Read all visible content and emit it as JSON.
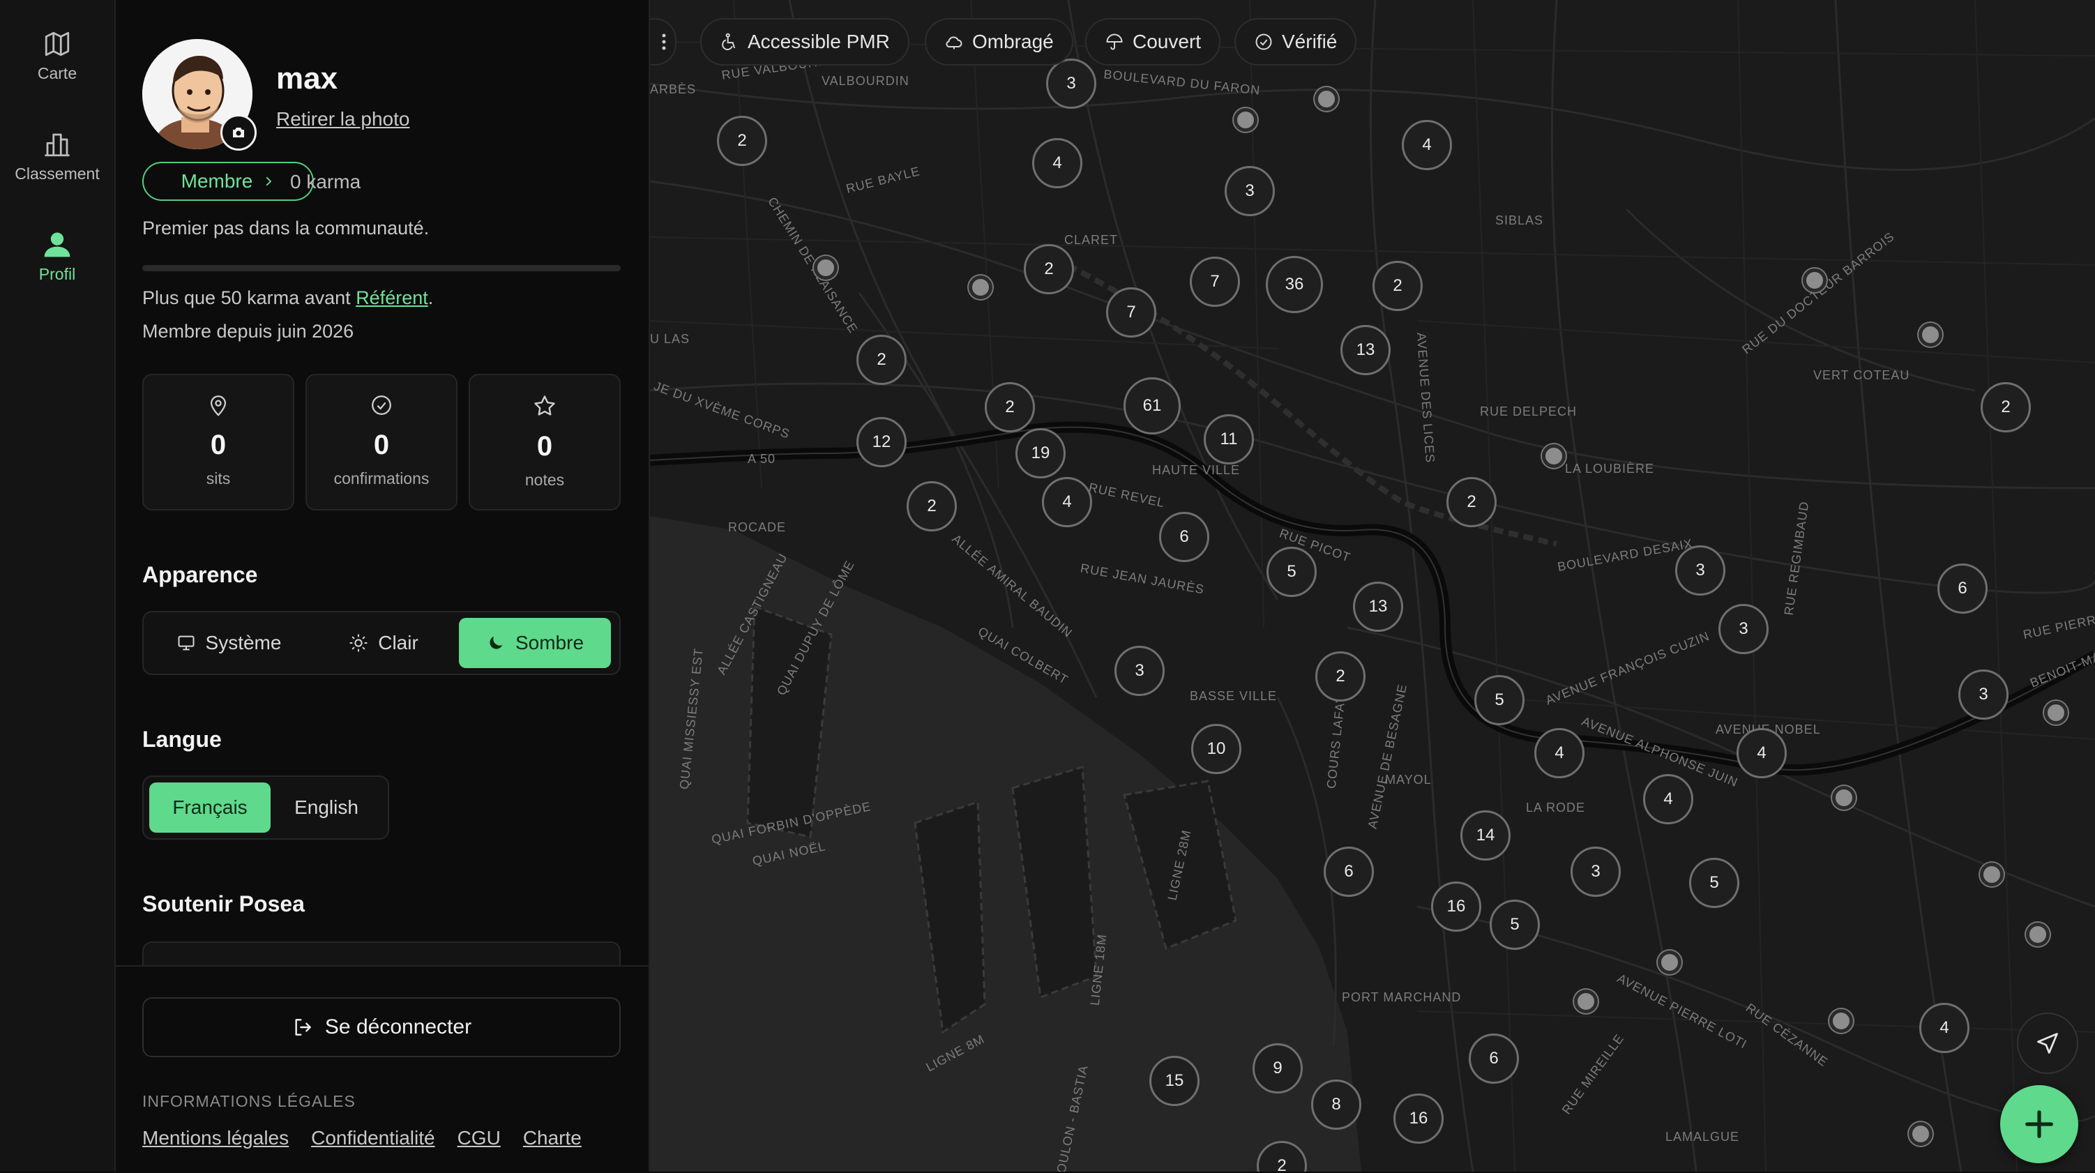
{
  "nav": {
    "items": [
      {
        "label": "Carte",
        "icon": "map-icon"
      },
      {
        "label": "Classement",
        "icon": "leaderboard-icon"
      },
      {
        "label": "Profil",
        "icon": "user-icon",
        "active": true
      }
    ]
  },
  "profile": {
    "username": "max",
    "remove_photo": "Retirer la photo",
    "role": "Membre",
    "karma": "0 karma",
    "tagline": "Premier pas dans la communauté.",
    "progress_fraction": 0,
    "next_level_prefix": "Plus que 50 karma avant ",
    "next_level_name": "Référent",
    "next_level_suffix": ".",
    "member_since": "Membre depuis juin 2026",
    "stats": [
      {
        "value": "0",
        "label": "sits",
        "icon": "pin-icon"
      },
      {
        "value": "0",
        "label": "confirmations",
        "icon": "check-circle-icon"
      },
      {
        "value": "0",
        "label": "notes",
        "icon": "star-icon"
      }
    ]
  },
  "appearance": {
    "title": "Apparence",
    "options": [
      {
        "label": "Système",
        "icon": "monitor-icon"
      },
      {
        "label": "Clair",
        "icon": "sun-icon"
      },
      {
        "label": "Sombre",
        "icon": "moon-icon",
        "active": true
      }
    ]
  },
  "language": {
    "title": "Langue",
    "options": [
      {
        "label": "Français",
        "active": true
      },
      {
        "label": "English"
      }
    ]
  },
  "support": {
    "title": "Soutenir Posea"
  },
  "footer": {
    "logout": "Se déconnecter",
    "legal_title": "INFORMATIONS LÉGALES",
    "legal_links": [
      "Mentions légales",
      "Confidentialité",
      "CGU",
      "Charte"
    ]
  },
  "filters": [
    {
      "label": "Accessible PMR",
      "icon": "wheelchair-icon"
    },
    {
      "label": "Ombragé",
      "icon": "cloud-icon"
    },
    {
      "label": "Couvert",
      "icon": "umbrella-icon"
    },
    {
      "label": "Vérifié",
      "icon": "check-circle-icon"
    }
  ],
  "map_labels": [
    "VALBOURDIN",
    "RUE VALBOURDIN",
    "BOULEVARD DU FARON",
    "ARBÈS",
    "RUE BAYLE",
    "SIBLAS",
    "CLARET",
    "CHEMIN DE PLAISANCE",
    "RUE DU DOCTEUR BARROIS",
    "VERT COTEAU",
    "U LAS",
    "JE DU XVÈME CORPS",
    "RUE DELPECH",
    "AVENUE DES LICES",
    "LA LOUBIÈRE",
    "A 50",
    "HAUTE VILLE",
    "RUE REVEL",
    "ROCADE",
    "RUE PICOT",
    "BOULEVARD DESAIX",
    "RUE REGIMBAUD",
    "RUE PIERRE",
    "BENOIT-MA",
    "ALLÉE AMIRAL BAUDIN",
    "RUE JEAN JAURÈS",
    "QUAI COLBERT",
    "ALLÉE CASTIGNEAU",
    "QUAI DUPUY DE LÔME",
    "QUAI MISSIESSY EST",
    "BASSE VILLE",
    "COURS LAFAYETTE",
    "AVENUE FRANÇOIS CUZIN",
    "AVENUE NOBEL",
    "AVENUE ALPHONSE JUIN",
    "MAYOL",
    "AVENUE DE BESAGNE",
    "LA RODE",
    "QUAI FORBIN D'OPPÈDE",
    "QUAI NOËL",
    "LIGNE 28M",
    "LIGNE 18M",
    "LIGNE 8M",
    "PORT MARCHAND",
    "AVENUE PIERRE LOTI",
    "RUE CÉZANNE",
    "RUE MIREILLE",
    "TOULON - BASTIA",
    "LAMALGUE"
  ],
  "clusters": [
    "3",
    "4",
    "2",
    "4",
    "3",
    "2",
    "7",
    "7",
    "36",
    "2",
    "13",
    "2",
    "2",
    "61",
    "11",
    "12",
    "19",
    "2",
    "4",
    "6",
    "2",
    "5",
    "13",
    "3",
    "2",
    "5",
    "6",
    "3",
    "3",
    "4",
    "4",
    "4",
    "10",
    "2",
    "3",
    "14",
    "6",
    "16",
    "5",
    "3",
    "5",
    "4",
    "6",
    "9",
    "15",
    "8",
    "16",
    "2"
  ]
}
